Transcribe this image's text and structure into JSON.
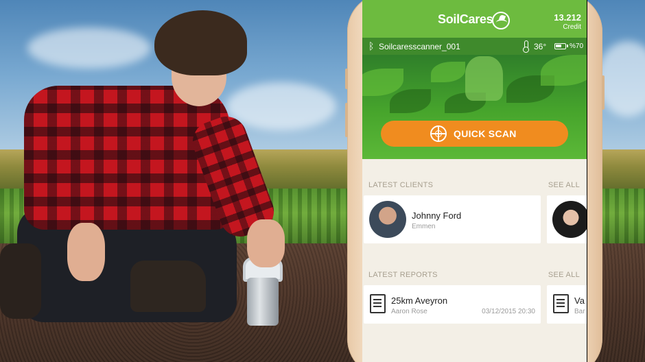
{
  "app": {
    "brand": "SoilCares",
    "credit_value": "13.212",
    "credit_label": "Credit"
  },
  "status": {
    "device_name": "Soilcaresscanner_001",
    "temperature": "36°",
    "battery_label": "%70",
    "battery_level": 0.7
  },
  "hero": {
    "quick_scan_label": "QUICK SCAN"
  },
  "clients": {
    "title": "LATEST CLIENTS",
    "see_all": "SEE ALL",
    "items": [
      {
        "name": "Johnny Ford",
        "location": "Emmen"
      },
      {
        "name": "",
        "location": ""
      }
    ]
  },
  "reports": {
    "title": "LATEST REPORTS",
    "see_all": "SEE ALL",
    "items": [
      {
        "title": "25km Aveyron",
        "author": "Aaron Rose",
        "date": "03/12/2015 20:30"
      },
      {
        "title": "Va",
        "author": "Bar",
        "date": ""
      }
    ]
  },
  "colors": {
    "header_green": "#6dbb3f",
    "status_green": "#3f8a2c",
    "accent_orange": "#f08c1f",
    "panel_bg": "#f3efe6"
  },
  "icons": [
    "soilcares-logo-icon",
    "bluetooth-icon",
    "thermometer-icon",
    "battery-icon",
    "crosshair-scan-icon",
    "report-document-icon"
  ]
}
